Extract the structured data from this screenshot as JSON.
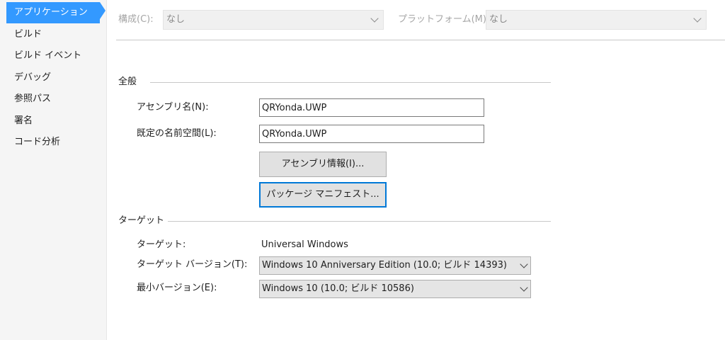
{
  "sidebar": {
    "items": [
      {
        "label": "アプリケーション",
        "active": true
      },
      {
        "label": "ビルド"
      },
      {
        "label": "ビルド イベント"
      },
      {
        "label": "デバッグ"
      },
      {
        "label": "参照パス"
      },
      {
        "label": "署名"
      },
      {
        "label": "コード分析"
      }
    ]
  },
  "topbar": {
    "config_label": "構成(C):",
    "config_value": "なし",
    "platform_label": "プラットフォーム(M):",
    "platform_value": "なし"
  },
  "general": {
    "heading": "全般",
    "assembly_name_label": "アセンブリ名(N):",
    "assembly_name_value": "QRYonda.UWP",
    "default_namespace_label": "既定の名前空間(L):",
    "default_namespace_value": "QRYonda.UWP",
    "assembly_info_button": "アセンブリ情報(I)...",
    "package_manifest_button": "パッケージ マニフェスト..."
  },
  "target": {
    "heading": "ターゲット",
    "target_label": "ターゲット:",
    "target_value": "Universal Windows",
    "target_version_label": "ターゲット バージョン(T):",
    "target_version_value": "Windows 10 Anniversary Edition (10.0; ビルド 14393)",
    "min_version_label": "最小バージョン(E):",
    "min_version_value": "Windows 10 (10.0; ビルド 10586)"
  },
  "colors": {
    "accent": "#3399ff",
    "focus_border": "#0078d7"
  }
}
